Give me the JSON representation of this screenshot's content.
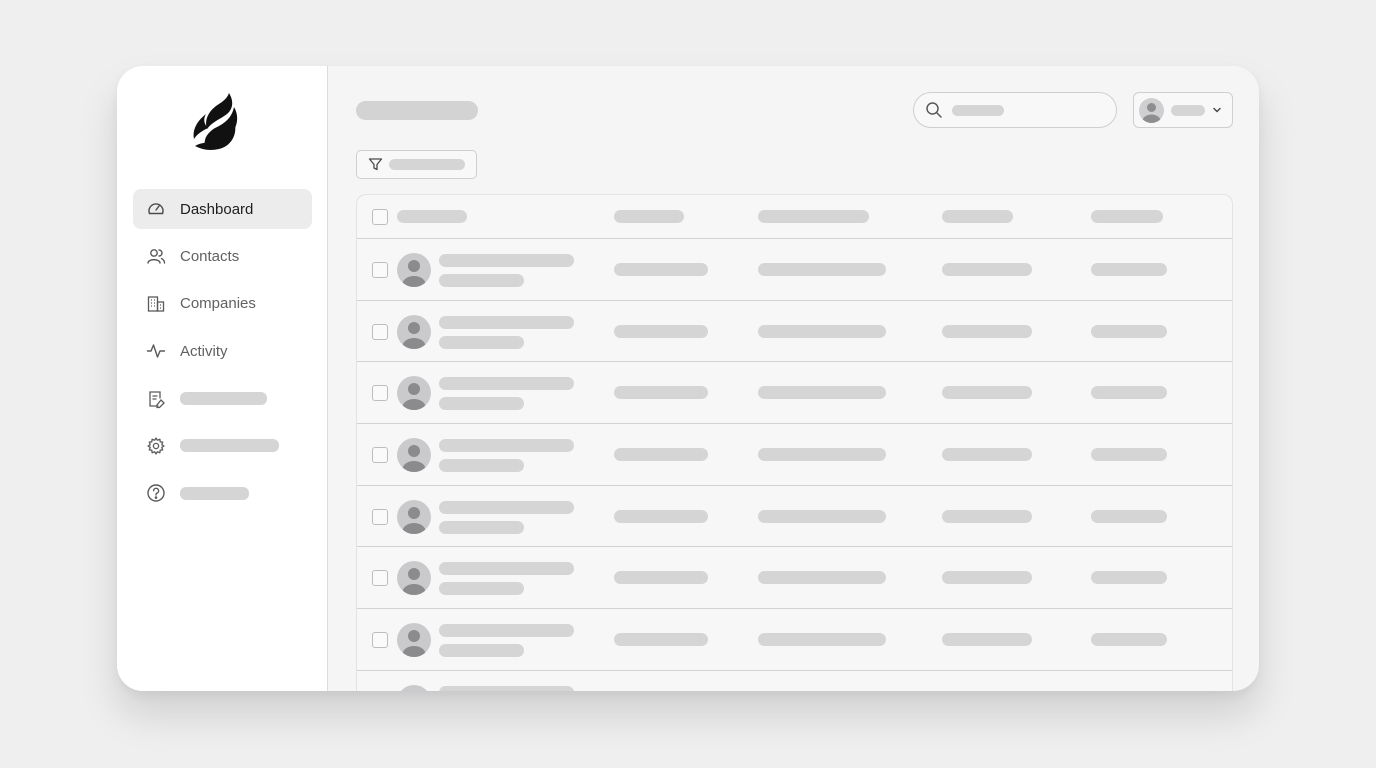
{
  "app": {
    "logo_icon": "flame-logo-icon",
    "accent": "#111111",
    "placeholder_color": "#d5d5d6"
  },
  "sidebar": {
    "items": [
      {
        "icon": "gauge-icon",
        "label": "Dashboard",
        "active": true
      },
      {
        "icon": "users-icon",
        "label": "Contacts",
        "active": false
      },
      {
        "icon": "building-icon",
        "label": "Companies",
        "active": false
      },
      {
        "icon": "pulse-icon",
        "label": "Activity",
        "active": false
      },
      {
        "icon": "document-edit-icon",
        "label": "",
        "active": false
      },
      {
        "icon": "gear-icon",
        "label": "",
        "active": false
      },
      {
        "icon": "help-circle-icon",
        "label": "",
        "active": false
      }
    ]
  },
  "header": {
    "title": "",
    "search": {
      "icon": "search-icon",
      "placeholder": ""
    },
    "user_menu": {
      "icon": "chevron-down-icon",
      "name": ""
    }
  },
  "toolbar": {
    "filter": {
      "icon": "filter-icon",
      "label": ""
    }
  },
  "table": {
    "columns": [
      "",
      "",
      "",
      "",
      ""
    ],
    "rows": [
      {
        "name": "",
        "subtitle": "",
        "cells": [
          "",
          "",
          "",
          ""
        ]
      },
      {
        "name": "",
        "subtitle": "",
        "cells": [
          "",
          "",
          "",
          ""
        ]
      },
      {
        "name": "",
        "subtitle": "",
        "cells": [
          "",
          "",
          "",
          ""
        ]
      },
      {
        "name": "",
        "subtitle": "",
        "cells": [
          "",
          "",
          "",
          ""
        ]
      },
      {
        "name": "",
        "subtitle": "",
        "cells": [
          "",
          "",
          "",
          ""
        ]
      },
      {
        "name": "",
        "subtitle": "",
        "cells": [
          "",
          "",
          "",
          ""
        ]
      },
      {
        "name": "",
        "subtitle": "",
        "cells": [
          "",
          "",
          "",
          ""
        ]
      },
      {
        "name": "",
        "subtitle": "",
        "cells": [
          "",
          "",
          "",
          ""
        ]
      }
    ]
  }
}
